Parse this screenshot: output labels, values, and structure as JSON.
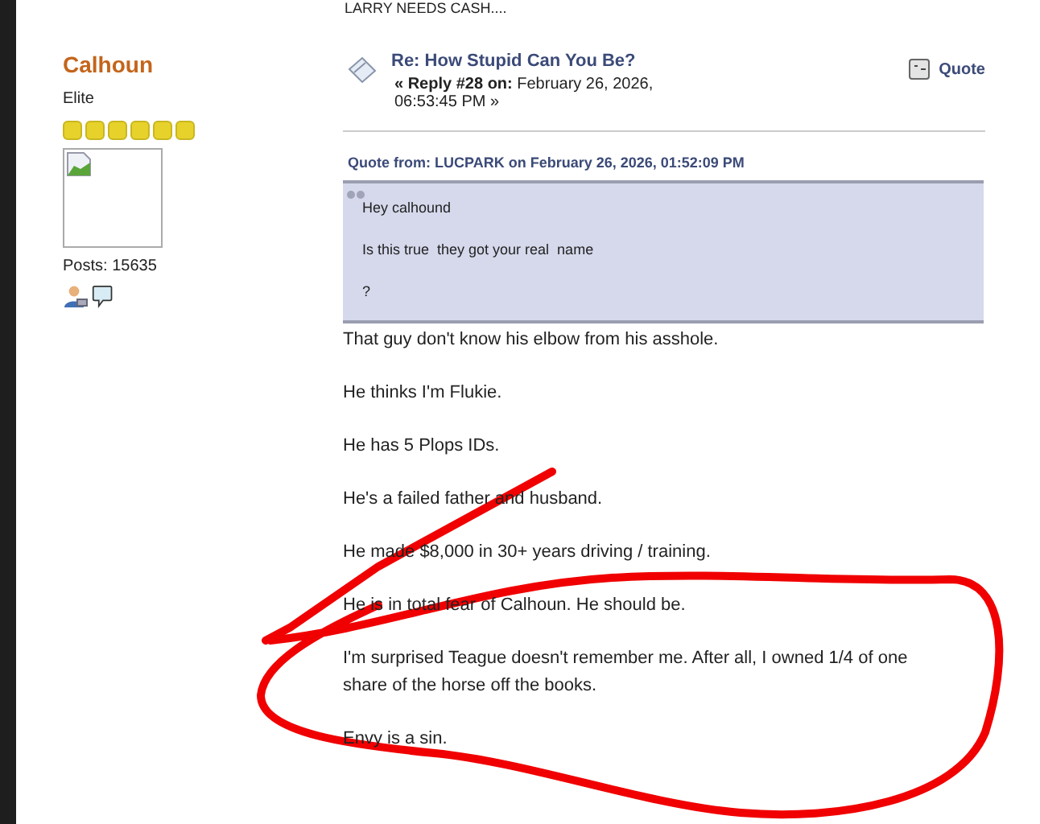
{
  "previous_post_text": "LARRY NEEDS CASH....",
  "author": {
    "name": "Calhoun",
    "rank": "Elite",
    "stars": 6,
    "posts": "Posts: 15635"
  },
  "post": {
    "title": "Re: How Stupid Can You Be?",
    "reply_label": "« Reply #28 on:",
    "date": "February 26, 2026, 06:53:45 PM »",
    "quote_button": "Quote"
  },
  "quote": {
    "header": "Quote from: LUCPARK on February 26, 2026, 01:52:09 PM",
    "lines": [
      "Hey calhound",
      "Is this true  they got your real  name",
      "?"
    ]
  },
  "body": [
    "That guy don't know his elbow from his asshole.",
    "He thinks I'm Flukie.",
    "He has 5 Plops IDs.",
    "He's a failed father and husband.",
    "He made $8,000 in 30+ years driving / training.",
    "He is in total fear of Calhoun. He should be.",
    "I'm surprised Teague doesn't remember me. After all, I owned 1/4 of one share of the horse off the books.",
    "Envy is a sin."
  ]
}
